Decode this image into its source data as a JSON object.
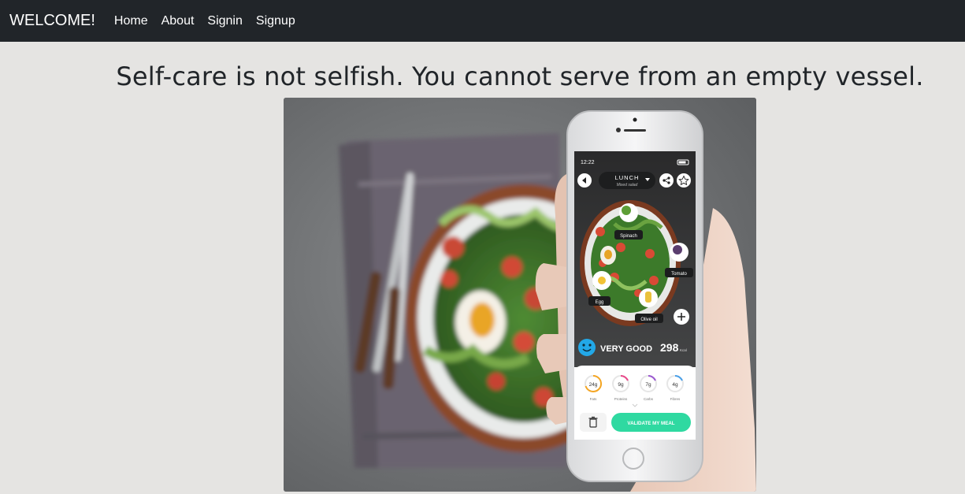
{
  "navbar": {
    "brand": "WELCOME!",
    "links": [
      "Home",
      "About",
      "Signin",
      "Signup"
    ]
  },
  "hero": {
    "quote": "Self-care is not selfish. You cannot serve from an empty vessel."
  },
  "phone_screen": {
    "time": "12:22",
    "meal_title": "LUNCH",
    "meal_subtitle": "Mixed salad",
    "tags": [
      "Spinach",
      "Tomato",
      "Egg",
      "Olive oil"
    ],
    "rating": "VERY GOOD",
    "calories": "298",
    "calories_unit": "Kcal",
    "nutrients": [
      {
        "value": "24g",
        "label": "Fats"
      },
      {
        "value": "9g",
        "label": "Proteins"
      },
      {
        "value": "7g",
        "label": "Carbs"
      },
      {
        "value": "4g",
        "label": "Fibres"
      }
    ],
    "validate_label": "VALIDATE MY MEAL"
  },
  "colors": {
    "navbar_bg": "#212529",
    "page_bg": "#e5e4e2",
    "accent_green": "#2fd9a1",
    "rating_blue": "#22a8e8"
  },
  "icons": {
    "phone_back": "chevron-left-icon",
    "phone_share": "share-icon",
    "phone_favorite": "star-icon",
    "phone_add": "plus-icon",
    "phone_delete": "trash-icon"
  }
}
